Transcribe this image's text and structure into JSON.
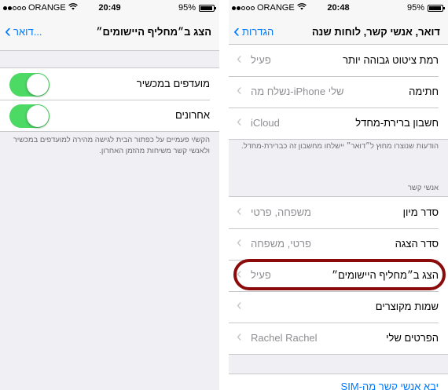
{
  "status": {
    "left": {
      "carrier": "ORANGE",
      "time": "20:49",
      "battery": "95%",
      "battery_level": 0.95
    },
    "right": {
      "carrier": "ORANGE",
      "time": "20:48",
      "battery": "95%",
      "battery_level": 0.95
    }
  },
  "left_screen": {
    "nav": {
      "back_label": "דואר...",
      "title": "הצג ב״מחליף היישומים״"
    },
    "rows": [
      {
        "label": "מועדפים במכשיר",
        "on": true
      },
      {
        "label": "אחרונים",
        "on": true
      }
    ],
    "footer": "הקש/י פעמיים על כפתור הבית לגישה מהירה למועדפים במכשיר ולאנשי קשר משיחות מהזמן האחרון."
  },
  "right_screen": {
    "nav": {
      "back_label": "הגדרות",
      "title": "דואר, אנשי קשר, לוחות שנה"
    },
    "group1": [
      {
        "label": "רמת ציטוט גבוהה יותר",
        "value": "פעיל"
      },
      {
        "label": "חתימה",
        "value": "נשלח מה-iPhone שלי"
      },
      {
        "label": "חשבון ברירת-מחדל",
        "value": "iCloud"
      }
    ],
    "group1_footer": "הודעות שנוצרו מחוץ ל״דואר״ יישלחו מחשבון זה כברירת-מחדל.",
    "contacts_header": "אנשי קשר",
    "group2": [
      {
        "label": "סדר מיון",
        "value": "משפחה, פרטי"
      },
      {
        "label": "סדר הצגה",
        "value": "פרטי, משפחה"
      },
      {
        "label": "הצג ב״מחליף היישומים״",
        "value": "פעיל"
      },
      {
        "label": "שמות מקוצרים",
        "value": ""
      },
      {
        "label": "הפרטים שלי",
        "value": "Rachel Rachel"
      }
    ],
    "import_sim_label": "יבא אנשי קשר מה-SIM"
  },
  "colors": {
    "accent": "#007aff",
    "toggle_on": "#4cd964",
    "highlight": "#8b0a0a"
  }
}
